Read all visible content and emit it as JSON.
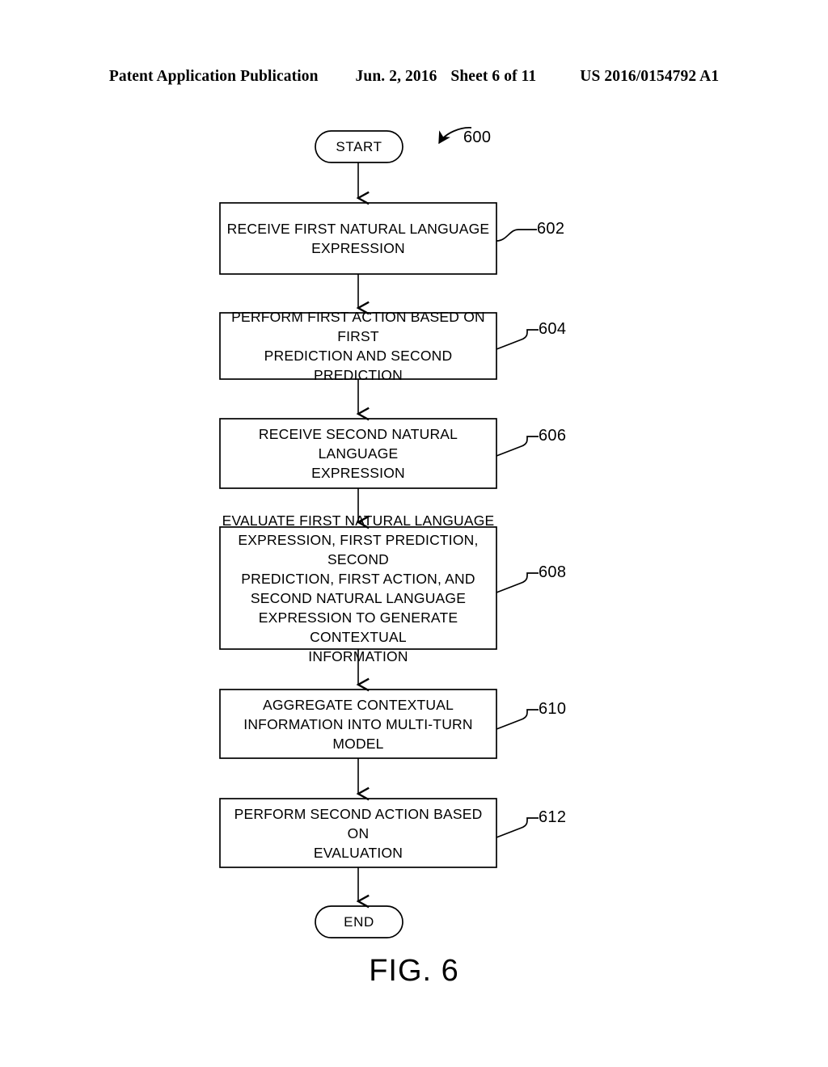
{
  "header": {
    "title": "Patent Application Publication",
    "date": "Jun. 2, 2016",
    "sheet": "Sheet 6 of 11",
    "patent_number": "US 2016/0154792 A1"
  },
  "figure": {
    "caption": "FIG. 6",
    "diagram_reference": "600",
    "nodes": [
      {
        "id": "start",
        "shape": "terminal",
        "label": "START",
        "ref": null
      },
      {
        "id": "step-602",
        "shape": "process",
        "label": "RECEIVE FIRST NATURAL LANGUAGE\nEXPRESSION",
        "ref": "602"
      },
      {
        "id": "step-604",
        "shape": "process",
        "label": "PERFORM FIRST ACTION BASED ON FIRST\nPREDICTION AND SECOND PREDICTION",
        "ref": "604"
      },
      {
        "id": "step-606",
        "shape": "process",
        "label": "RECEIVE SECOND NATURAL LANGUAGE\nEXPRESSION",
        "ref": "606"
      },
      {
        "id": "step-608",
        "shape": "process",
        "label": "EVALUATE FIRST NATURAL LANGUAGE\nEXPRESSION, FIRST PREDICTION, SECOND\nPREDICTION, FIRST ACTION, AND\nSECOND NATURAL LANGUAGE\nEXPRESSION TO GENERATE CONTEXTUAL\nINFORMATION",
        "ref": "608"
      },
      {
        "id": "step-610",
        "shape": "process",
        "label": "AGGREGATE CONTEXTUAL\nINFORMATION INTO MULTI-TURN\nMODEL",
        "ref": "610"
      },
      {
        "id": "step-612",
        "shape": "process",
        "label": "PERFORM SECOND ACTION BASED ON\nEVALUATION",
        "ref": "612"
      },
      {
        "id": "end",
        "shape": "terminal",
        "label": "END",
        "ref": null
      }
    ]
  },
  "colors": {
    "ink": "#000000",
    "paper": "#ffffff"
  }
}
